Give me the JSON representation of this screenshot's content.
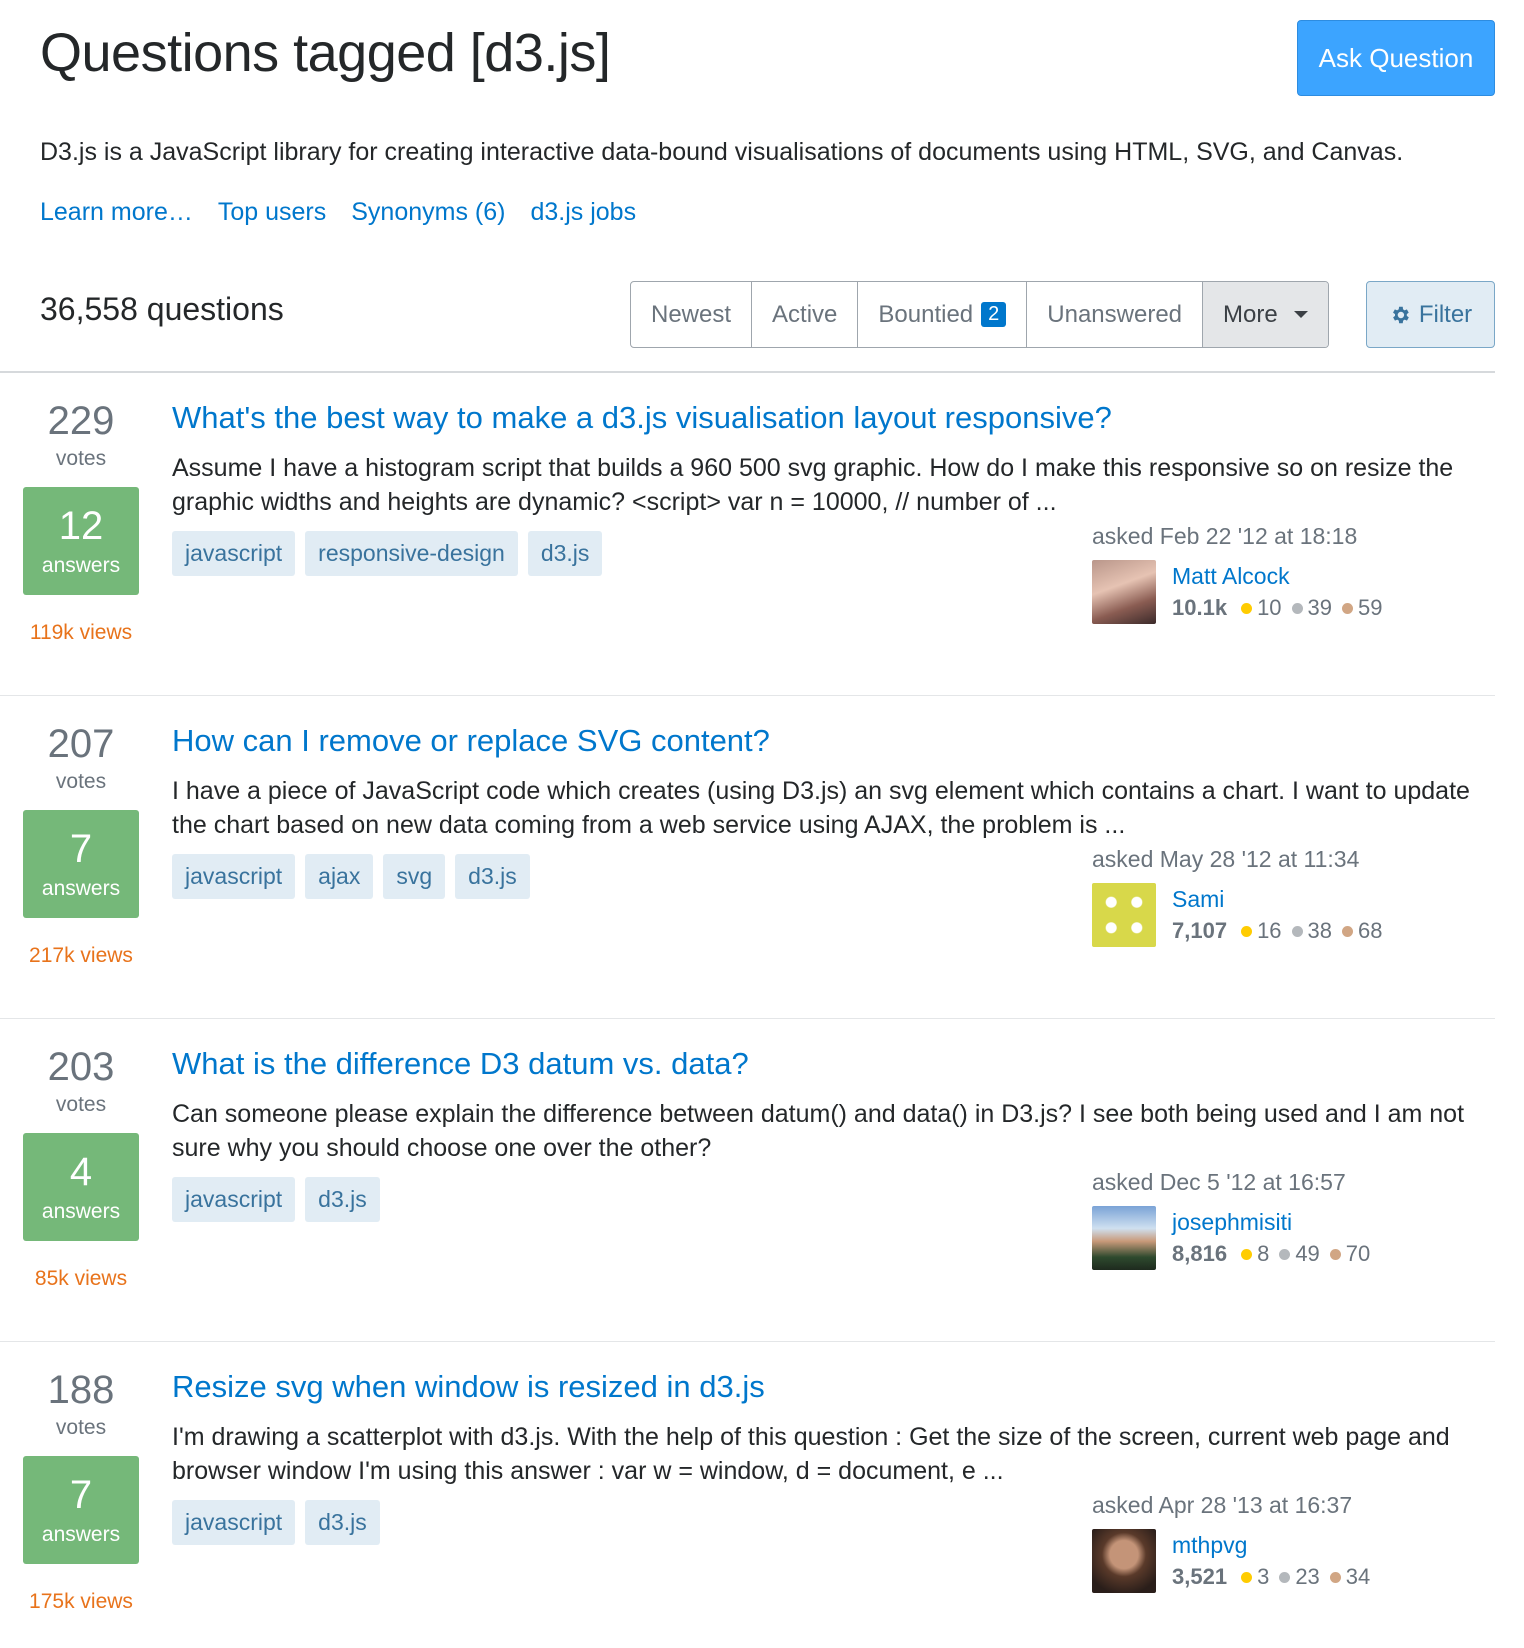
{
  "header": {
    "title": "Questions tagged [d3.js]",
    "ask_button": "Ask Question",
    "description": "D3.js is a JavaScript library for creating interactive data-bound visualisations of documents using HTML, SVG, and Canvas.",
    "links": [
      "Learn more…",
      "Top users",
      "Synonyms (6)",
      "d3.js jobs"
    ]
  },
  "toolbar": {
    "count": "36,558 questions",
    "tabs": {
      "newest": "Newest",
      "active": "Active",
      "bountied": "Bountied",
      "bountied_badge": "2",
      "unanswered": "Unanswered",
      "more": "More"
    },
    "filter": "Filter"
  },
  "questions": [
    {
      "votes": "229",
      "votes_label": "votes",
      "answers": "12",
      "answers_label": "answers",
      "views": "119k views",
      "title": "What's the best way to make a d3.js visualisation layout responsive?",
      "excerpt": "Assume I have a histogram script that builds a 960 500 svg graphic. How do I make this responsive so on resize the graphic widths and heights are dynamic? <script> var n = 10000, // number of ...",
      "tags": [
        "javascript",
        "responsive-design",
        "d3.js"
      ],
      "asked": "asked Feb 22 '12 at 18:18",
      "user": "Matt Alcock",
      "rep": "10.1k",
      "gold": "10",
      "silver": "39",
      "bronze": "59"
    },
    {
      "votes": "207",
      "votes_label": "votes",
      "answers": "7",
      "answers_label": "answers",
      "views": "217k views",
      "title": "How can I remove or replace SVG content?",
      "excerpt": "I have a piece of JavaScript code which creates (using D3.js) an svg element which contains a chart. I want to update the chart based on new data coming from a web service using AJAX, the problem is ...",
      "tags": [
        "javascript",
        "ajax",
        "svg",
        "d3.js"
      ],
      "asked": "asked May 28 '12 at 11:34",
      "user": "Sami",
      "rep": "7,107",
      "gold": "16",
      "silver": "38",
      "bronze": "68"
    },
    {
      "votes": "203",
      "votes_label": "votes",
      "answers": "4",
      "answers_label": "answers",
      "views": "85k views",
      "title": "What is the difference D3 datum vs. data?",
      "excerpt": "Can someone please explain the difference between datum() and data() in D3.js? I see both being used and I am not sure why you should choose one over the other?",
      "tags": [
        "javascript",
        "d3.js"
      ],
      "asked": "asked Dec 5 '12 at 16:57",
      "user": "josephmisiti",
      "rep": "8,816",
      "gold": "8",
      "silver": "49",
      "bronze": "70"
    },
    {
      "votes": "188",
      "votes_label": "votes",
      "answers": "7",
      "answers_label": "answers",
      "views": "175k views",
      "title": "Resize svg when window is resized in d3.js",
      "excerpt": "I'm drawing a scatterplot with d3.js. With the help of this question : Get the size of the screen, current web page and browser window I'm using this answer : var w = window, d = document, e ...",
      "tags": [
        "javascript",
        "d3.js"
      ],
      "asked": "asked Apr 28 '13 at 16:37",
      "user": "mthpvg",
      "rep": "3,521",
      "gold": "3",
      "silver": "23",
      "bronze": "34"
    }
  ]
}
